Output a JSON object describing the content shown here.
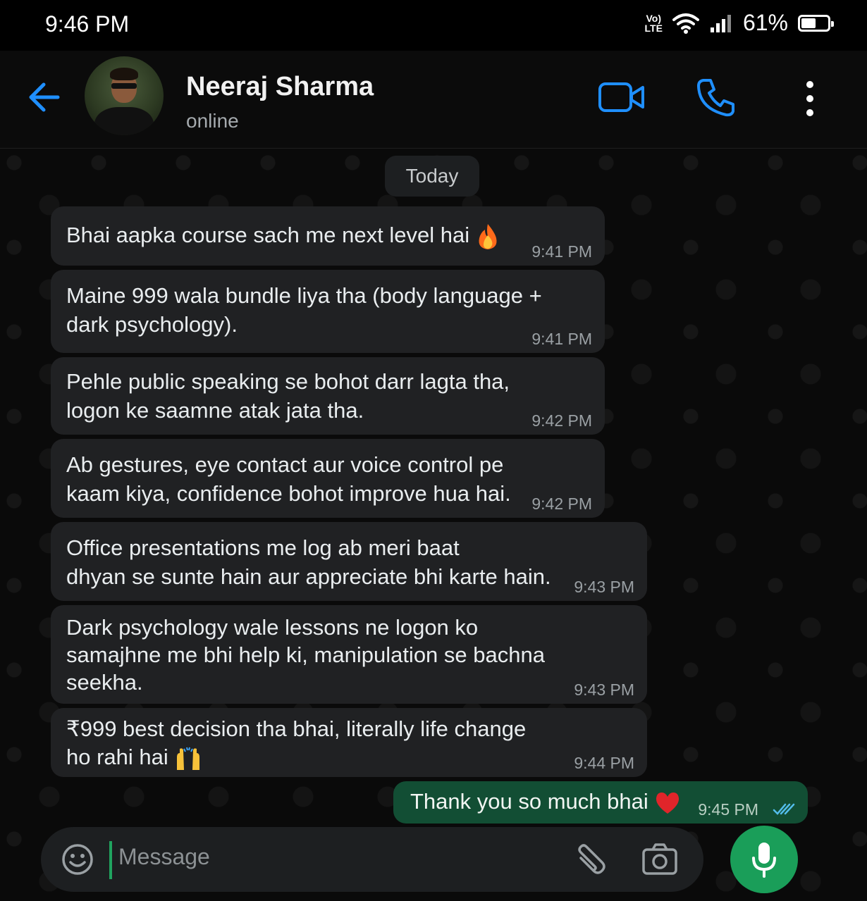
{
  "status_bar": {
    "time": "9:46 PM",
    "volte_top": "Vo)",
    "volte_bottom": "LTE",
    "battery_percent": "61%",
    "battery_level": 0.61
  },
  "header": {
    "contact_name": "Neeraj Sharma",
    "status": "online"
  },
  "chat": {
    "day_label": "Today",
    "messages": [
      {
        "direction": "incoming",
        "text": "Bhai aapka course sach me next level hai",
        "emoji": "fire",
        "time": "9:41 PM"
      },
      {
        "direction": "incoming",
        "text": "Maine 999 wala bundle liya tha (body language +\ndark psychology).",
        "time": "9:41 PM"
      },
      {
        "direction": "incoming",
        "text": "Pehle public speaking se bohot darr lagta tha,\nlogon ke saamne atak jata tha.",
        "time": "9:42 PM"
      },
      {
        "direction": "incoming",
        "text": "Ab gestures, eye contact aur voice control pe\nkaam kiya, confidence bohot improve hua hai.",
        "time": "9:42 PM"
      },
      {
        "direction": "incoming",
        "text": "Office presentations me log ab meri baat\ndhyan se sunte hain aur appreciate bhi karte hain.",
        "time": "9:43 PM"
      },
      {
        "direction": "incoming",
        "text": "Dark psychology wale lessons ne logon ko\nsamajhne me bhi help ki, manipulation se bachna\nseekha.",
        "time": "9:43 PM"
      },
      {
        "direction": "incoming",
        "text": "₹999 best decision tha bhai, literally life change\nho rahi hai",
        "emoji": "raising-hands",
        "time": "9:44 PM"
      },
      {
        "direction": "outgoing",
        "text": "Thank you so much bhai",
        "emoji": "red-heart",
        "time": "9:45 PM",
        "read": true
      }
    ]
  },
  "composer": {
    "placeholder": "Message"
  },
  "colors": {
    "accent_blue": "#1f8fff",
    "incoming_bubble": "#202123",
    "outgoing_bubble": "#124e34",
    "mic_green": "#1a9e59"
  }
}
